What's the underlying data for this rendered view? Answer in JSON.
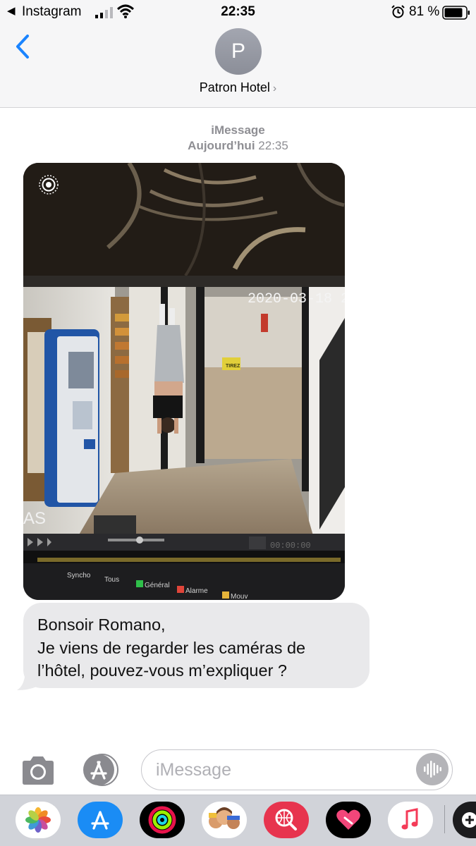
{
  "status_bar": {
    "back_app": "Instagram",
    "time": "22:35",
    "battery": "81 %"
  },
  "header": {
    "avatar_initial": "P",
    "contact_name": "Patron Hotel",
    "chevron": "›"
  },
  "conversation": {
    "service": "iMessage",
    "day": "Aujourd’hui",
    "time": "22:35",
    "photo": {
      "overlay_timestamp": "2020-03-18 2",
      "sign_tirez": "TIREZ",
      "sign_as": "AS",
      "playback_time": "00:00:00",
      "filter_synchro": "Syncho",
      "filter_tous": "Tous",
      "filter_general": "Général",
      "filter_alarme": "Alarme",
      "filter_mouv": "Mouv"
    },
    "message_lines": [
      "Bonsoir Romano,",
      "Je viens de regarder les caméras de",
      "l’hôtel, pouvez-vous m’expliquer ?"
    ]
  },
  "input_bar": {
    "placeholder": "iMessage"
  },
  "icons": {
    "camera": "camera-icon",
    "apps": "app-store-icon",
    "voice": "waveform-icon",
    "back": "chevron-left-icon"
  },
  "drawer_apps": [
    "Photos",
    "App Store",
    "Activity",
    "Memoji",
    "Web Search",
    "Heart",
    "Music",
    "More"
  ],
  "colors": {
    "ios_blue": "#1a84ff",
    "bubble_gray": "#e9e9eb",
    "meta_gray": "#8e8e93"
  }
}
